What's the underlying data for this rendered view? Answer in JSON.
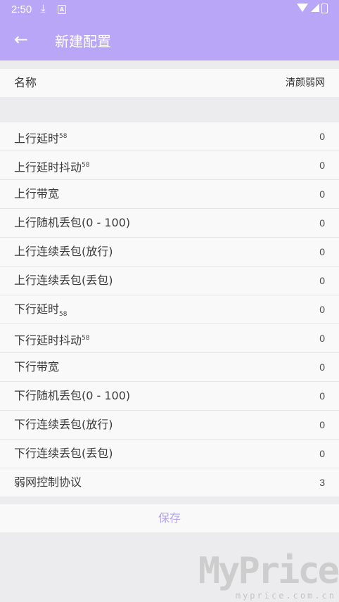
{
  "status": {
    "time": "2:50",
    "download_icon": "download-icon",
    "a_badge": "A"
  },
  "toolbar": {
    "back_icon": "←",
    "title": "新建配置"
  },
  "name_row": {
    "label": "名称",
    "value": "清颜弱网"
  },
  "items": [
    {
      "label": "上行延时",
      "sup": "58",
      "sub": "",
      "value": "0"
    },
    {
      "label": "上行延时抖动",
      "sup": "58",
      "sub": "",
      "value": "0"
    },
    {
      "label": "上行带宽",
      "sup": "",
      "sub": "",
      "value": "0"
    },
    {
      "label": "上行随机丢包(0 - 100)",
      "sup": "",
      "sub": "",
      "value": "0"
    },
    {
      "label": "上行连续丢包(放行)",
      "sup": "",
      "sub": "",
      "value": "0"
    },
    {
      "label": "上行连续丢包(丢包)",
      "sup": "",
      "sub": "",
      "value": "0"
    },
    {
      "label": "下行延时",
      "sup": "",
      "sub": "58",
      "value": "0"
    },
    {
      "label": "下行延时抖动",
      "sup": "58",
      "sub": "",
      "value": "0"
    },
    {
      "label": "下行带宽",
      "sup": "",
      "sub": "",
      "value": "0"
    },
    {
      "label": "下行随机丢包(0 - 100)",
      "sup": "",
      "sub": "",
      "value": "0"
    },
    {
      "label": "下行连续丢包(放行)",
      "sup": "",
      "sub": "",
      "value": "0"
    },
    {
      "label": "下行连续丢包(丢包)",
      "sup": "",
      "sub": "",
      "value": "0"
    },
    {
      "label": "弱网控制协议",
      "sup": "",
      "sub": "",
      "value": "3"
    }
  ],
  "save_label": "保存",
  "watermark": {
    "main": "MyPrice",
    "sub": "myprice.com.cn"
  },
  "colors": {
    "accent": "#b9a6f7",
    "save_text": "#b6a5ee",
    "background": "#ececee",
    "row_background": "#f9f9fa"
  }
}
